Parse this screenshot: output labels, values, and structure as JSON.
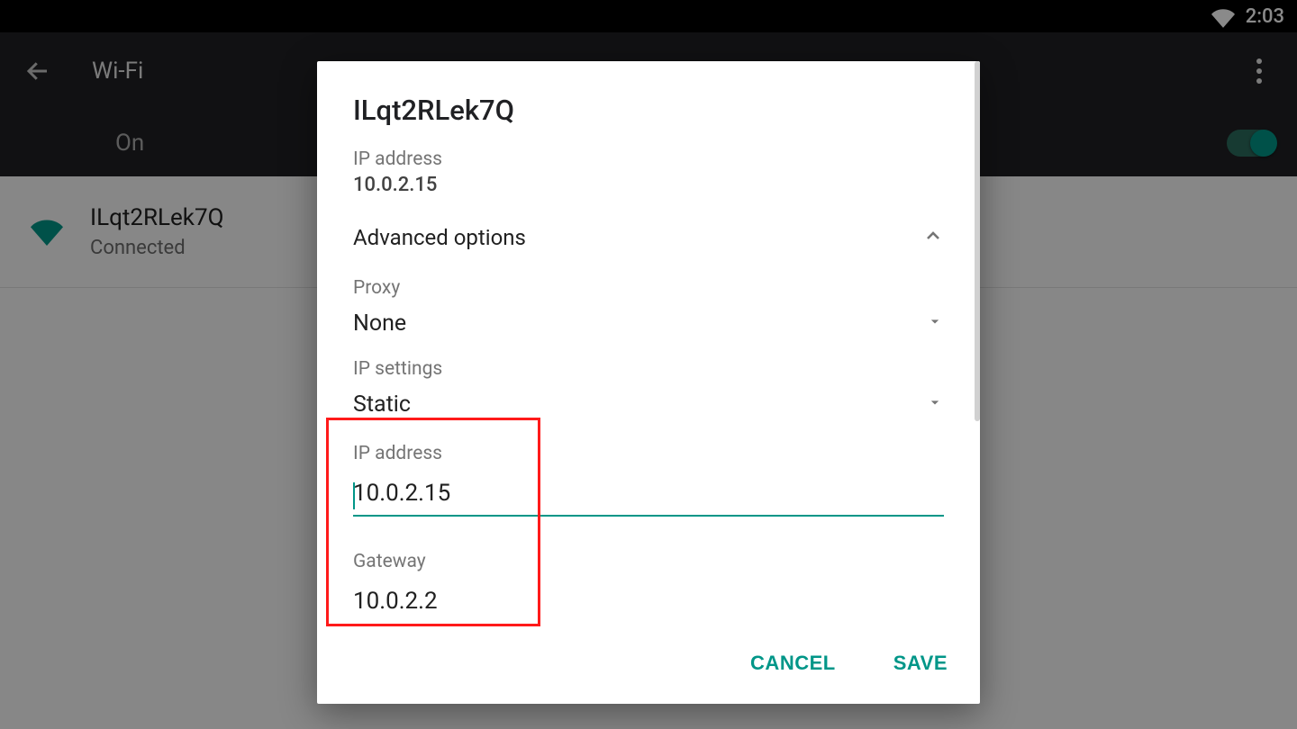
{
  "status": {
    "time": "2:03"
  },
  "appbar": {
    "title": "Wi-Fi"
  },
  "subbar": {
    "label": "On",
    "toggle_on": true
  },
  "network": {
    "name": "ILqt2RLek7Q",
    "status": "Connected"
  },
  "dialog": {
    "title": "ILqt2RLek7Q",
    "ip_label": "IP address",
    "ip_value": "10.0.2.15",
    "advanced_label": "Advanced options",
    "proxy_label": "Proxy",
    "proxy_value": "None",
    "ipsettings_label": "IP settings",
    "ipsettings_value": "Static",
    "input_ip_label": "IP address",
    "input_ip_value": "10.0.2.15",
    "gateway_label": "Gateway",
    "gateway_value": "10.0.2.2",
    "cancel": "CANCEL",
    "save": "SAVE"
  }
}
